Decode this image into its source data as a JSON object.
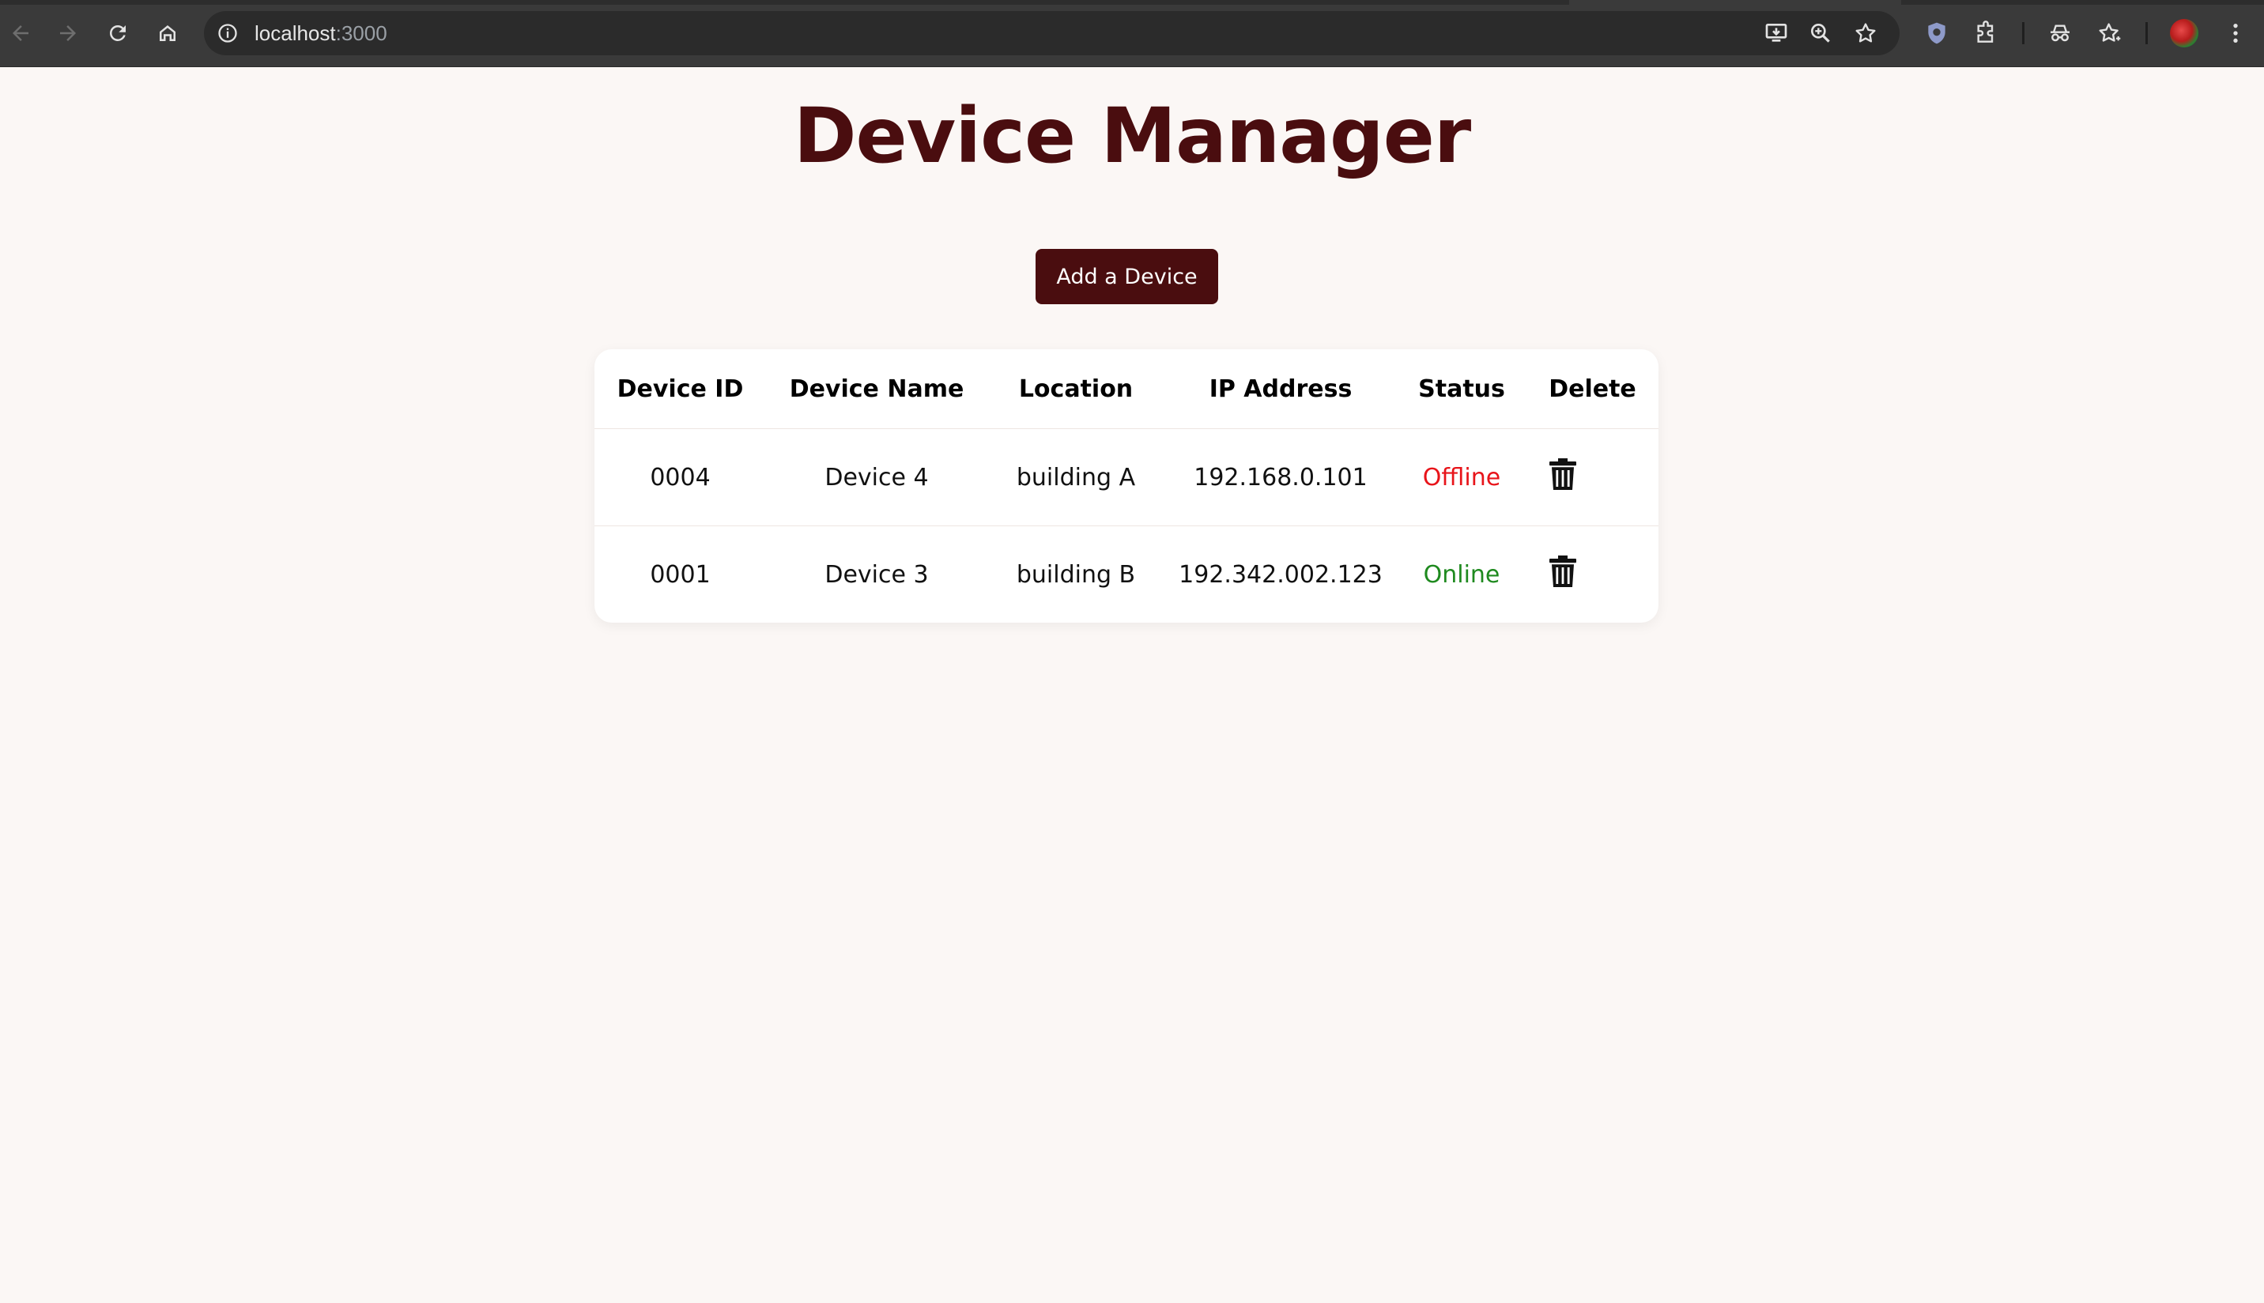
{
  "browser": {
    "url_host": "localhost",
    "url_port": ":3000",
    "icons": [
      "back-icon",
      "forward-icon",
      "reload-icon",
      "home-icon",
      "info-icon",
      "install-icon",
      "zoom-icon",
      "bookmark-star-icon",
      "shield-extension-icon",
      "extensions-puzzle-icon",
      "incognito-icon",
      "reading-list-icon",
      "profile-avatar",
      "menu-kebab-icon"
    ]
  },
  "page": {
    "title": "Device Manager",
    "add_button_label": "Add a Device"
  },
  "table": {
    "headers": [
      "Device ID",
      "Device Name",
      "Location",
      "IP Address",
      "Status",
      "Delete"
    ],
    "rows": [
      {
        "id": "0004",
        "name": "Device 4",
        "location": "building A",
        "ip": "192.168.0.101",
        "status": "Offline"
      },
      {
        "id": "0001",
        "name": "Device 3",
        "location": "building B",
        "ip": "192.342.002.123",
        "status": "Online"
      }
    ]
  },
  "colors": {
    "brand": "#4a0d0f",
    "background": "#fbf7f5",
    "offline": "#e8141a",
    "online": "#1f8a1f"
  }
}
